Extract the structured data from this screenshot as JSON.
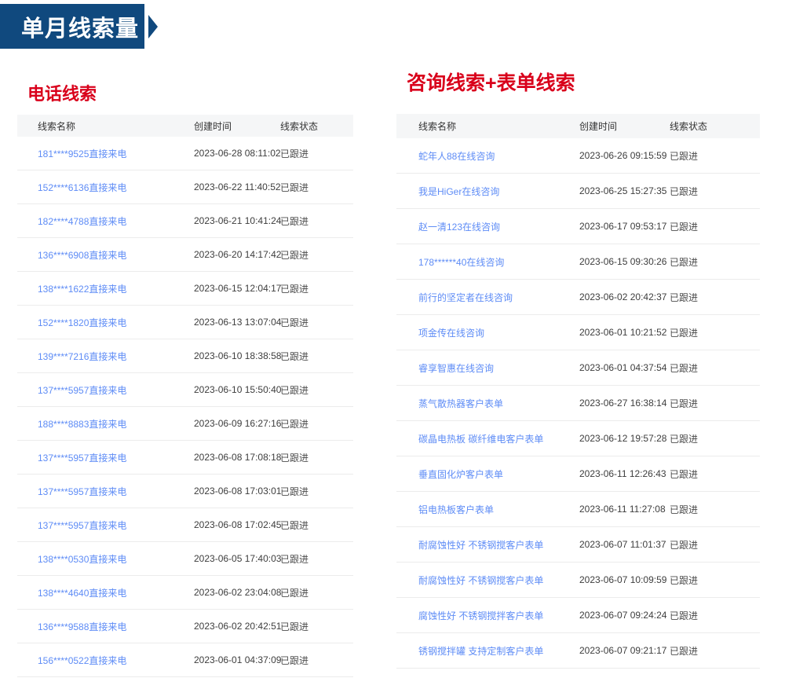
{
  "banner": {
    "title": "单月线索量"
  },
  "colors": {
    "banner_navy": "#10497e",
    "title_red": "#d9001b",
    "link_blue": "#5e8cf6",
    "table_header_bg": "#f5f6f7",
    "row_divider": "#ececec"
  },
  "phone_section": {
    "title": "电话线索",
    "columns": [
      "线索名称",
      "创建时间",
      "线索状态"
    ],
    "rows": [
      {
        "name": "181****9525直接来电",
        "time": "2023-06-28 08:11:02",
        "status": "已跟进"
      },
      {
        "name": "152****6136直接来电",
        "time": "2023-06-22 11:40:52",
        "status": "已跟进"
      },
      {
        "name": "182****4788直接来电",
        "time": "2023-06-21 10:41:24",
        "status": "已跟进"
      },
      {
        "name": "136****6908直接来电",
        "time": "2023-06-20 14:17:42",
        "status": "已跟进"
      },
      {
        "name": "138****1622直接来电",
        "time": "2023-06-15 12:04:17",
        "status": "已跟进"
      },
      {
        "name": "152****1820直接来电",
        "time": "2023-06-13 13:07:04",
        "status": "已跟进"
      },
      {
        "name": "139****7216直接来电",
        "time": "2023-06-10 18:38:58",
        "status": "已跟进"
      },
      {
        "name": "137****5957直接来电",
        "time": "2023-06-10 15:50:40",
        "status": "已跟进"
      },
      {
        "name": "188****8883直接来电",
        "time": "2023-06-09 16:27:16",
        "status": "已跟进"
      },
      {
        "name": "137****5957直接来电",
        "time": "2023-06-08 17:08:18",
        "status": "已跟进"
      },
      {
        "name": "137****5957直接来电",
        "time": "2023-06-08 17:03:01",
        "status": "已跟进"
      },
      {
        "name": "137****5957直接来电",
        "time": "2023-06-08 17:02:45",
        "status": "已跟进"
      },
      {
        "name": "138****0530直接来电",
        "time": "2023-06-05 17:40:03",
        "status": "已跟进"
      },
      {
        "name": "138****4640直接来电",
        "time": "2023-06-02 23:04:08",
        "status": "已跟进"
      },
      {
        "name": "136****9588直接来电",
        "time": "2023-06-02 20:42:51",
        "status": "已跟进"
      },
      {
        "name": "156****0522直接来电",
        "time": "2023-06-01 04:37:09",
        "status": "已跟进"
      }
    ]
  },
  "consult_section": {
    "title": "咨询线索+表单线索",
    "columns": [
      "线索名称",
      "创建时间",
      "线索状态"
    ],
    "rows": [
      {
        "name": "蛇年人88在线咨询",
        "time": "2023-06-26 09:15:59",
        "status": "已跟进"
      },
      {
        "name": "我是HiGer在线咨询",
        "time": "2023-06-25 15:27:35",
        "status": "已跟进"
      },
      {
        "name": "赵一清123在线咨询",
        "time": "2023-06-17 09:53:17",
        "status": "已跟进"
      },
      {
        "name": "178******40在线咨询",
        "time": "2023-06-15 09:30:26",
        "status": "已跟进"
      },
      {
        "name": "前行的坚定者在线咨询",
        "time": "2023-06-02 20:42:37",
        "status": "已跟进"
      },
      {
        "name": "项金传在线咨询",
        "time": "2023-06-01 10:21:52",
        "status": "已跟进"
      },
      {
        "name": "睿享智惠在线咨询",
        "time": "2023-06-01 04:37:54",
        "status": "已跟进"
      },
      {
        "name": "蒸气散热器客户表单",
        "time": "2023-06-27 16:38:14",
        "status": "已跟进"
      },
      {
        "name": "碳晶电热板 碳纤维电客户表单",
        "time": "2023-06-12 19:57:28",
        "status": "已跟进"
      },
      {
        "name": "垂直固化炉客户表单",
        "time": "2023-06-11 12:26:43",
        "status": "已跟进"
      },
      {
        "name": "铝电热板客户表单",
        "time": "2023-06-11 11:27:08",
        "status": "已跟进"
      },
      {
        "name": "耐腐蚀性好 不锈钢搅客户表单",
        "time": "2023-06-07 11:01:37",
        "status": "已跟进"
      },
      {
        "name": "耐腐蚀性好 不锈钢搅客户表单",
        "time": "2023-06-07 10:09:59",
        "status": "已跟进"
      },
      {
        "name": "腐蚀性好 不锈钢搅拌客户表单",
        "time": "2023-06-07 09:24:24",
        "status": "已跟进"
      },
      {
        "name": "锈钢搅拌罐 支持定制客户表单",
        "time": "2023-06-07 09:21:17",
        "status": "已跟进"
      }
    ]
  }
}
